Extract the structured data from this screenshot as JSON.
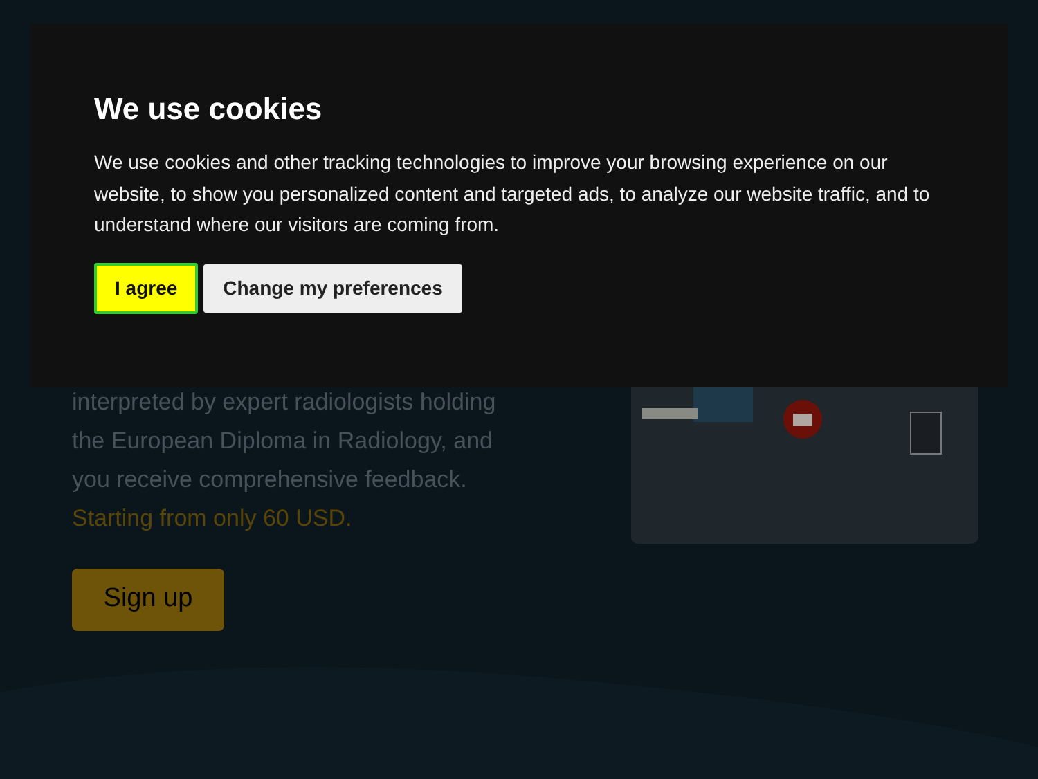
{
  "background_page": {
    "description": "interpreted by expert radiologists holding\nthe European Diploma in Radiology, and\nyou receive comprehensive feedback.",
    "price_note": "Starting from only 60 USD.",
    "signup_button": "Sign up"
  },
  "cookie_dialog": {
    "title": "We use cookies",
    "message": "We use cookies and other tracking technologies to improve your browsing experience on our website, to show you personalized content and targeted ads, to analyze our website traffic, and to understand where our visitors are coming from.",
    "buttons": [
      {
        "label": "I agree",
        "kind": "primary"
      },
      {
        "label": "Change my preferences",
        "kind": "secondary"
      }
    ]
  }
}
